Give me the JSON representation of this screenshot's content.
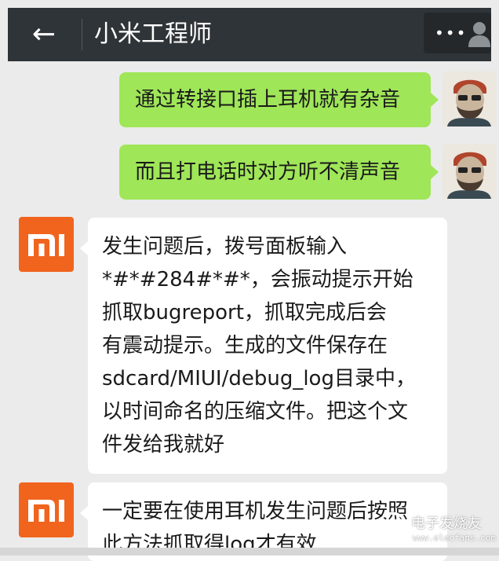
{
  "header": {
    "back_icon": "←",
    "title": "小米工程师",
    "more_icon": "•••",
    "colors": {
      "bar": "#2f3438",
      "text": "#ffffff"
    }
  },
  "messages": [
    {
      "sender": "me",
      "text": "通过转接口插上耳机就有杂音"
    },
    {
      "sender": "me",
      "text": "而且打电话时对方听不清声音"
    },
    {
      "sender": "engineer",
      "lines": [
        "发生问题后，拨号面板输入",
        "*#*#284#*#*，会振动提示开始",
        "抓取bugreport，抓取完成后会",
        "有震动提示。生成的文件保存在",
        "sdcard/MIUI/debug_log目录中，",
        "以时间命名的压缩文件。把这个文",
        "件发给我就好"
      ]
    },
    {
      "sender": "engineer",
      "lines": [
        "一定要在使用耳机发生问题后按照",
        "此方法抓取得log才有效"
      ]
    }
  ],
  "avatars": {
    "me": "user-portrait-icon",
    "engineer": "mi-logo-icon"
  },
  "watermark": {
    "text": "电子发烧友",
    "url": "www.elecfans.com"
  },
  "colors": {
    "my_bubble": "#9fe658",
    "their_bubble": "#ffffff",
    "mi_orange": "#f0641e",
    "background": "#ebebeb"
  }
}
